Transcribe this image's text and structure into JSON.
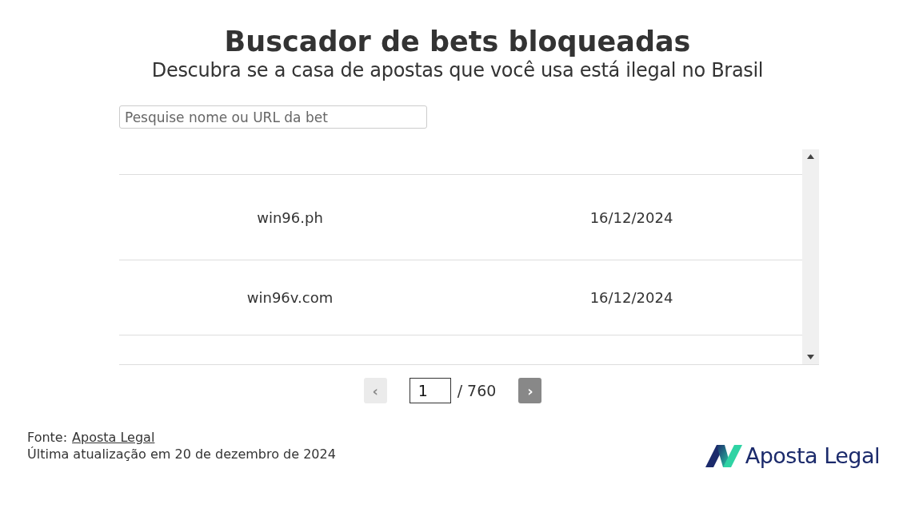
{
  "title": "Buscador de bets bloqueadas",
  "subtitle": "Descubra se a casa de apostas que você usa está ilegal no Brasil",
  "search": {
    "placeholder": "Pesquise nome ou URL da bet"
  },
  "table": {
    "rows": [
      {
        "name": "win96.ph",
        "date": "16/12/2024"
      },
      {
        "name": "win96v.com",
        "date": "16/12/2024"
      }
    ]
  },
  "pager": {
    "prev": {
      "label": "‹",
      "disabled": true
    },
    "page": "1",
    "total": "/ 760",
    "next": {
      "label": "›",
      "disabled": false
    }
  },
  "footer": {
    "source_label": "Fonte:",
    "source_link": "Aposta Legal",
    "updated": "Última atualização em 20 de dezembro de 2024"
  },
  "logo": {
    "text": "Aposta Legal"
  }
}
